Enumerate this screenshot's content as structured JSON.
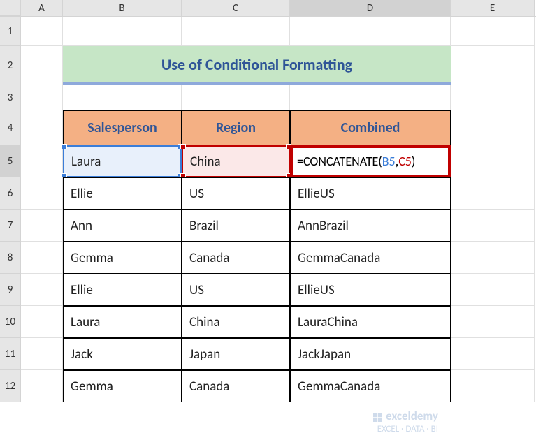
{
  "columns": [
    "A",
    "B",
    "C",
    "D",
    "E"
  ],
  "rows": [
    "1",
    "2",
    "3",
    "4",
    "5",
    "6",
    "7",
    "8",
    "9",
    "10",
    "11",
    "12"
  ],
  "title": "Use of Conditional Formatting",
  "headers": {
    "salesperson": "Salesperson",
    "region": "Region",
    "combined": "Combined"
  },
  "formula": {
    "eq": "=",
    "fn": "CONCATENATE(",
    "ref1": "B5",
    "comma": ",",
    "ref2": "C5",
    "close": ")"
  },
  "chart_data": {
    "type": "table",
    "columns": [
      "Salesperson",
      "Region",
      "Combined"
    ],
    "rows": [
      {
        "salesperson": "Laura",
        "region": "China",
        "combined": "=CONCATENATE(B5,C5)"
      },
      {
        "salesperson": "Ellie",
        "region": "US",
        "combined": "EllieUS"
      },
      {
        "salesperson": "Ann",
        "region": "Brazil",
        "combined": "AnnBrazil"
      },
      {
        "salesperson": "Gemma",
        "region": "Canada",
        "combined": "GemmaCanada"
      },
      {
        "salesperson": "Ellie",
        "region": "US",
        "combined": "EllieUS"
      },
      {
        "salesperson": "Laura",
        "region": "China",
        "combined": "LauraChina"
      },
      {
        "salesperson": "Jack",
        "region": "Japan",
        "combined": "JackJapan"
      },
      {
        "salesperson": "Gemma",
        "region": "Canada",
        "combined": "GemmaCanada"
      }
    ]
  },
  "watermark": {
    "brand": "exceldemy",
    "tag": "EXCEL · DATA · BI"
  }
}
